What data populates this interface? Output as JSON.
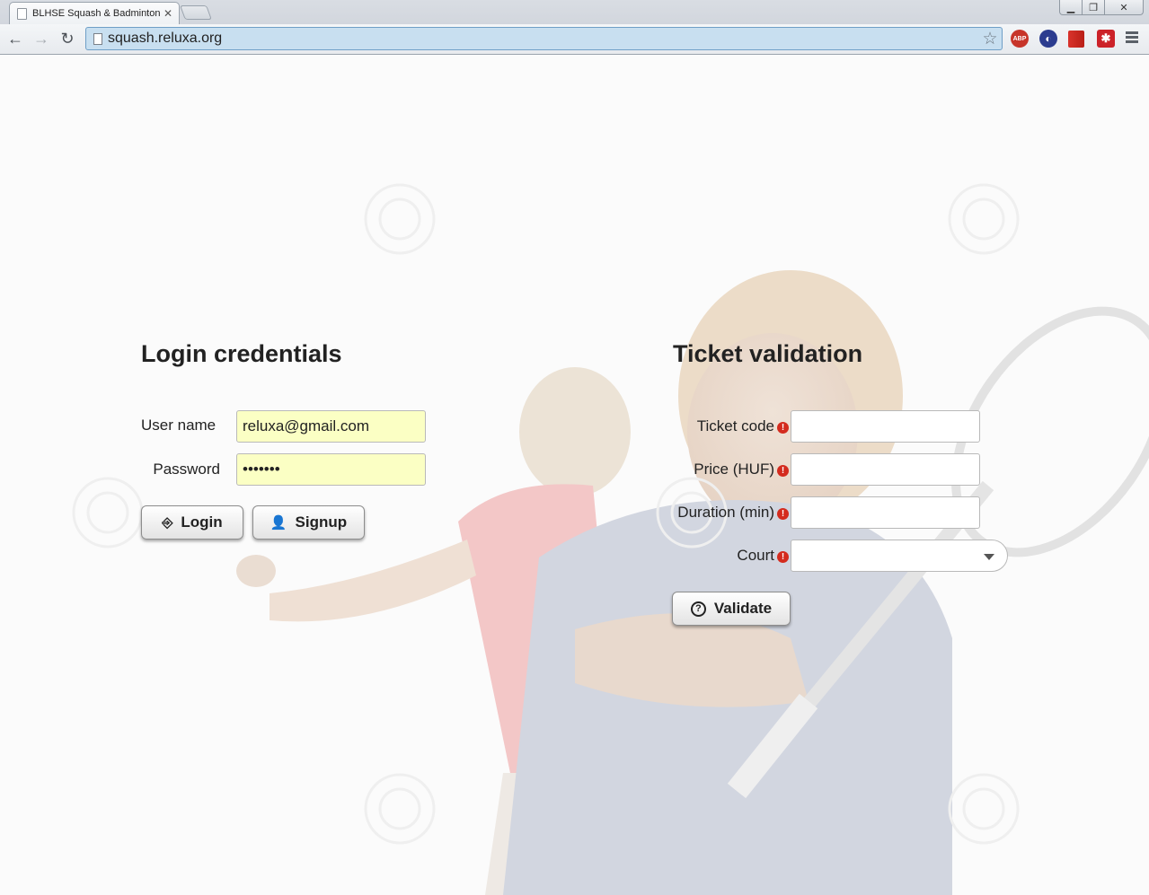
{
  "browser": {
    "tab_title": "BLHSE Squash & Badminton",
    "tab_close": "✕",
    "url": "squash.reluxa.org",
    "controls": {
      "minimize": "▁",
      "restore": "❐",
      "close": "✕"
    },
    "extensions": {
      "abp": "ABP",
      "sphere": "◐",
      "lastpass": "✱"
    },
    "nav": {
      "back": "←",
      "forward": "→",
      "reload": "↻",
      "star": "☆"
    }
  },
  "login": {
    "title": "Login credentials",
    "username_label": "User name",
    "username_value": "reluxa@gmail.com",
    "password_label": "Password",
    "password_value": "•••••••",
    "login_button": "Login",
    "login_icon": "⎆",
    "signup_button": "Signup",
    "signup_icon": "👤"
  },
  "ticket": {
    "title": "Ticket validation",
    "ticket_code_label": "Ticket code",
    "price_label": "Price (HUF)",
    "duration_label": "Duration (min)",
    "court_label": "Court",
    "required_icon": "!",
    "ticket_code_value": "",
    "price_value": "",
    "duration_value": "",
    "court_value": "",
    "validate_button": "Validate",
    "validate_icon": "?"
  },
  "colors": {
    "autofill_bg": "#fbffc4",
    "required_red": "#d42b1e",
    "omnibox_bg": "#c8dff0"
  }
}
